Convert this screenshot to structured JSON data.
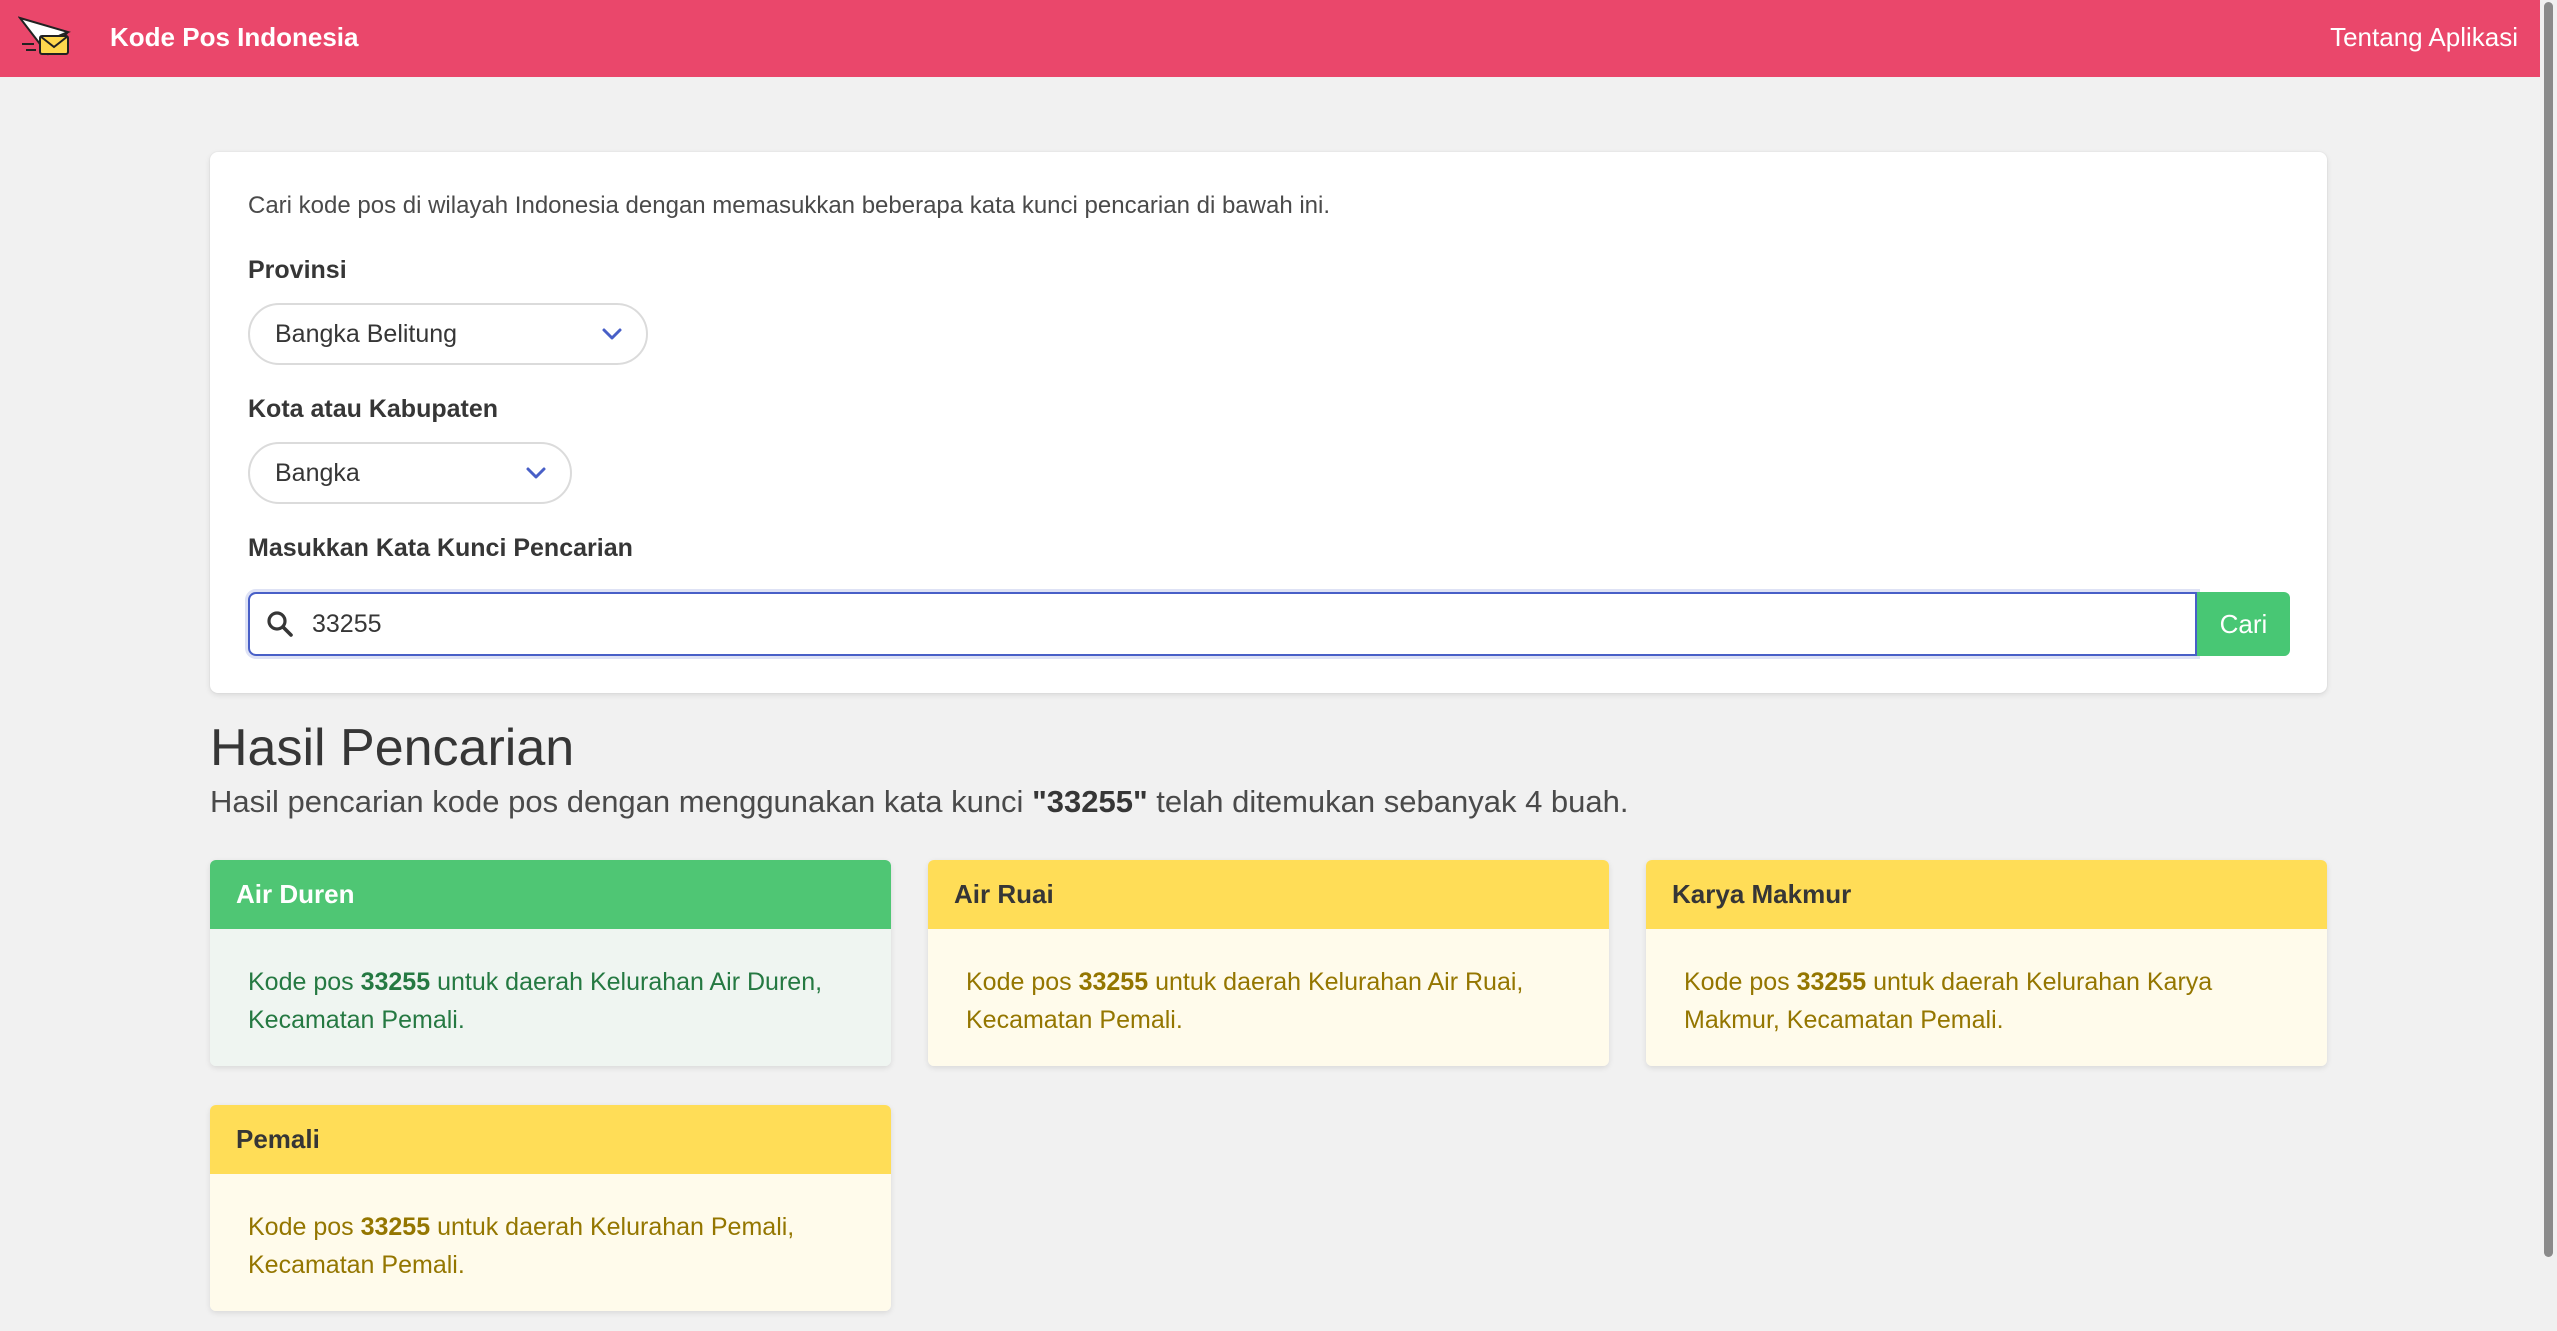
{
  "navbar": {
    "brand": "Kode Pos Indonesia",
    "about_link": "Tentang Aplikasi",
    "logo_icon": "envelope-plane-icon",
    "color": "#ea476b"
  },
  "search": {
    "intro": "Cari kode pos di wilayah Indonesia dengan memasukkan beberapa kata kunci pencarian di bawah ini.",
    "province_label": "Provinsi",
    "province_value": "Bangka Belitung",
    "city_label": "Kota atau Kabupaten",
    "city_value": "Bangka",
    "keyword_label": "Masukkan Kata Kunci Pencarian",
    "keyword_value": "33255",
    "search_button": "Cari",
    "button_color": "#48c774"
  },
  "results": {
    "title": "Hasil Pencarian",
    "subtitle_prefix": "Hasil pencarian kode pos dengan menggunakan kata kunci ",
    "subtitle_keyword": "\"33255\"",
    "subtitle_suffix": " telah ditemukan sebanyak 4 buah.",
    "items": [
      {
        "name": "Air Duren",
        "prefix": "Kode pos ",
        "code": "33255",
        "suffix": " untuk daerah Kelurahan Air Duren, Kecamatan Pemali.",
        "color": "green"
      },
      {
        "name": "Air Ruai",
        "prefix": "Kode pos ",
        "code": "33255",
        "suffix": " untuk daerah Kelurahan Air Ruai, Kecamatan Pemali.",
        "color": "yellow"
      },
      {
        "name": "Karya Makmur",
        "prefix": "Kode pos ",
        "code": "33255",
        "suffix": " untuk daerah Kelurahan Karya Makmur, Kecamatan Pemali.",
        "color": "yellow"
      },
      {
        "name": "Pemali",
        "prefix": "Kode pos ",
        "code": "33255",
        "suffix": " untuk daerah Kelurahan Pemali, Kecamatan Pemali.",
        "color": "yellow"
      }
    ]
  }
}
